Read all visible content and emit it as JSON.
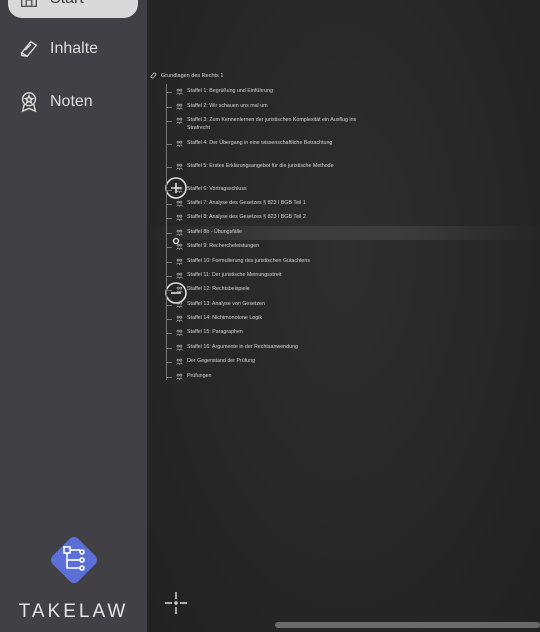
{
  "sidebar": {
    "items": [
      {
        "label": "Start",
        "icon": "home-icon"
      },
      {
        "label": "Inhalte",
        "icon": "book-icon"
      },
      {
        "label": "Noten",
        "icon": "award-icon"
      }
    ]
  },
  "logo": {
    "text": "TAKELAW",
    "color": "#5b6fd6"
  },
  "tree": {
    "root": "Grundlagen des Rechts 1",
    "nodes": [
      {
        "label": "Staffel 1: Begrüßung und Einführung"
      },
      {
        "label": "Staffel 2: Wir schauen uns mal um"
      },
      {
        "label": "Staffel 3: Zum Kennenlernen der juristischen Komplexität ein Ausflug ins Strafrecht"
      },
      {
        "label": "Staffel 4: Der Übergang in eine wissenschaftliche Betrachtung"
      },
      {
        "label": "Staffel 5: Erstes Erklärungsangebot für die juristische Methode"
      },
      {
        "label": "Staffel 6: Vortragsschluss"
      },
      {
        "label": "Staffel 7: Analyse des Gesetzes § 823 I BGB Teil 1"
      },
      {
        "label": "Staffel 8: Analyse des Gesetzes § 823 I BGB Teil 2"
      },
      {
        "label": "Staffel 8b - Übungsfälle"
      },
      {
        "label": "Staffel 9: Rechercheleistungen"
      },
      {
        "label": "Staffel 10: Formulierung des juristischen Gutachtens"
      },
      {
        "label": "Staffel 11: Der juristische Meinungsstreit"
      },
      {
        "label": "Staffel 12: Rechtsbeispiele"
      },
      {
        "label": "Staffel 13: Analyse von Gesetzen"
      },
      {
        "label": "Staffel 14: Nichtmonotone Logik"
      },
      {
        "label": "Staffel 15: Paragraphen"
      },
      {
        "label": "Staffel 16: Argumente in der Rechtsanwendung"
      },
      {
        "label": "Der Gegenstand der Prüfung"
      },
      {
        "label": "Prüfungen"
      }
    ]
  }
}
